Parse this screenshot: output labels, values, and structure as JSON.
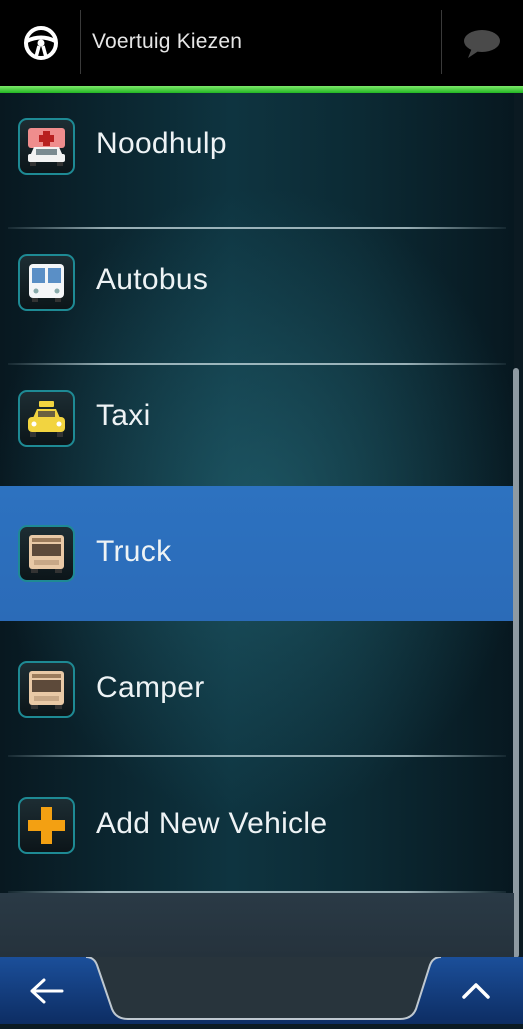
{
  "header": {
    "title": "Voertuig Kiezen",
    "left_icon": "steering-wheel-icon",
    "right_icon": "chat-bubble-icon"
  },
  "colors": {
    "accent_green": "#3fd33f",
    "selected_row": "#2d6fbd",
    "icon_border": "#1e8a94"
  },
  "vehicles": [
    {
      "label": "Noodhulp",
      "icon": "ambulance-icon",
      "selected": false
    },
    {
      "label": "Autobus",
      "icon": "bus-icon",
      "selected": false
    },
    {
      "label": "Taxi",
      "icon": "taxi-icon",
      "selected": false
    },
    {
      "label": "Truck",
      "icon": "truck-icon",
      "selected": true
    },
    {
      "label": "Camper",
      "icon": "camper-icon",
      "selected": false
    },
    {
      "label": "Add New Vehicle",
      "icon": "plus-icon",
      "selected": false
    }
  ],
  "footer": {
    "back_icon": "arrow-left-icon",
    "up_icon": "chevron-up-icon"
  }
}
